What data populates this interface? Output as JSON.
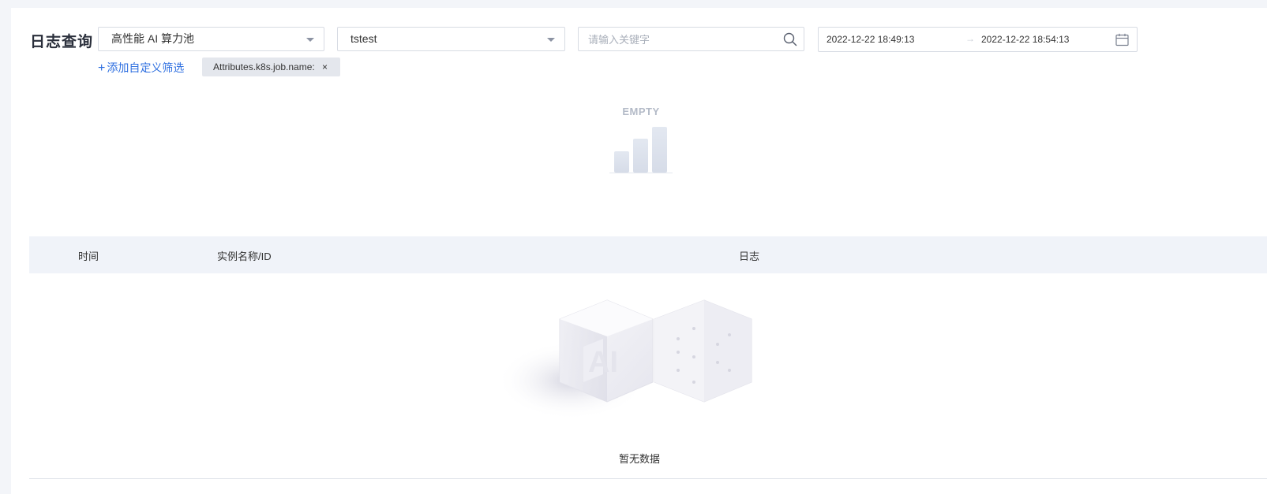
{
  "page": {
    "title": "日志查询"
  },
  "filters": {
    "pool_select": {
      "value": "高性能 AI 算力池"
    },
    "job_select": {
      "value": "tstest"
    },
    "search": {
      "placeholder": "请输入关键字",
      "value": ""
    },
    "date_range": {
      "start": "2022-12-22 18:49:13",
      "separator": "→",
      "end": "2022-12-22 18:54:13"
    },
    "add_filter_label": "添加自定义筛选",
    "active_tags": [
      {
        "label": "Attributes.k8s.job.name:",
        "close": "×"
      }
    ]
  },
  "chart_area": {
    "empty_label": "EMPTY"
  },
  "table": {
    "columns": [
      "时间",
      "实例名称/ID",
      "日志"
    ],
    "empty_text": "暂无数据",
    "illustration_text": "AI"
  },
  "colors": {
    "accent": "#2e6fe0",
    "header_bg": "#f0f3f9",
    "page_bg": "#f3f5f9"
  },
  "icons": {
    "search": "search-icon",
    "calendar": "calendar-icon",
    "dropdown": "chevron-down-icon",
    "close": "close-icon"
  }
}
